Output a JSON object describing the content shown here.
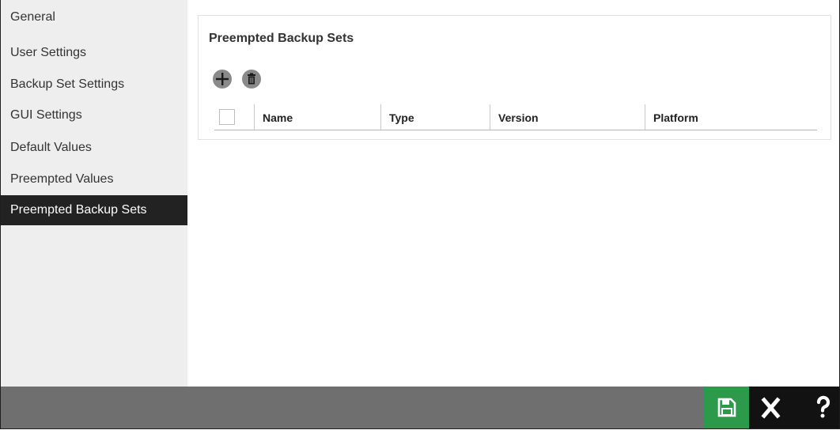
{
  "sidebar": {
    "items": [
      {
        "label": "General"
      },
      {
        "label": "User Settings"
      },
      {
        "label": "Backup Set Settings"
      },
      {
        "label": "GUI Settings"
      },
      {
        "label": "Default Values"
      },
      {
        "label": "Preempted Values"
      },
      {
        "label": "Preempted Backup Sets",
        "active": true
      }
    ]
  },
  "panel": {
    "title": "Preempted Backup Sets",
    "add_icon": "plus-icon",
    "delete_icon": "trash-icon"
  },
  "table": {
    "columns": [
      "Name",
      "Type",
      "Version",
      "Platform"
    ],
    "rows": []
  },
  "footer": {
    "save_icon": "save-icon",
    "close_icon": "close-icon",
    "help_icon": "help-icon"
  },
  "colors": {
    "sidebar_bg": "#eeeeee",
    "active_item_bg": "#222222",
    "footer_bg": "#6f6f6f",
    "save_button_bg": "#2d9a4b",
    "dark_button_bg": "#121212"
  }
}
